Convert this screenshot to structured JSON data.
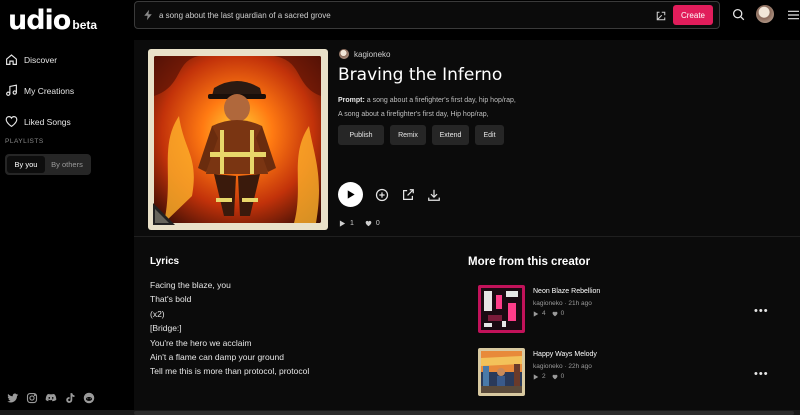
{
  "brand": {
    "name": "udio",
    "tag": "beta"
  },
  "sidebar": {
    "items": [
      {
        "label": "Discover",
        "icon": "home-icon"
      },
      {
        "label": "My Creations",
        "icon": "music-note-icon"
      },
      {
        "label": "Liked Songs",
        "icon": "heart-icon"
      }
    ],
    "playlists_label": "PLAYLISTS",
    "playlist_tabs": {
      "active": "By you",
      "inactive": "By others"
    },
    "socials": [
      "twitter-icon",
      "instagram-icon",
      "discord-icon",
      "tiktok-icon",
      "reddit-icon"
    ]
  },
  "topbar": {
    "search_placeholder": "a song about the last guardian of a sacred grove",
    "create_label": "Create"
  },
  "song": {
    "artist": "kagioneko",
    "title": "Braving the Inferno",
    "prompt_label": "Prompt:",
    "prompt_text": "a song about a firefighter's first day, hip hop/rap,",
    "tags": "A song about a firefighter's first day, Hip hop/rap,",
    "actions": [
      "Publish",
      "Remix",
      "Extend",
      "Edit"
    ],
    "plays": "1",
    "likes": "0"
  },
  "lyrics": {
    "title": "Lyrics",
    "lines": [
      "Facing the blaze, you",
      "That's bold",
      "(x2)",
      "[Bridge:]",
      "You're the hero we acclaim",
      "Ain't a flame can damp your ground",
      "Tell me this is more than protocol, protocol"
    ]
  },
  "more": {
    "title": "More from this creator",
    "items": [
      {
        "title": "Neon Blaze Rebellion",
        "meta": "kagioneko · 21h ago",
        "plays": "4",
        "likes": "0"
      },
      {
        "title": "Happy Ways Melody",
        "meta": "kagioneko · 22h ago",
        "plays": "2",
        "likes": "0"
      }
    ]
  },
  "colors": {
    "accent": "#e11d5b",
    "background": "#0b0b0b",
    "sidebar": "#000000"
  }
}
